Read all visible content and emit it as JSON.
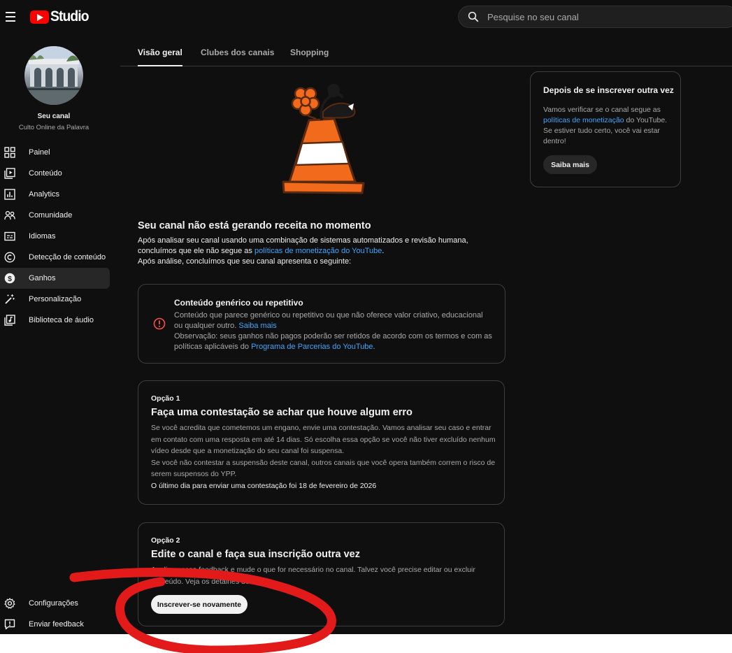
{
  "header": {
    "logo_text": "Studio",
    "search_placeholder": "Pesquise no seu canal"
  },
  "channel": {
    "title": "Seu canal",
    "name": "Culto Online da Palavra"
  },
  "sidebar": {
    "items": [
      {
        "label": "Painel",
        "icon": "dashboard-icon"
      },
      {
        "label": "Conteúdo",
        "icon": "content-icon"
      },
      {
        "label": "Analytics",
        "icon": "analytics-icon"
      },
      {
        "label": "Comunidade",
        "icon": "community-icon"
      },
      {
        "label": "Idiomas",
        "icon": "subtitles-icon"
      },
      {
        "label": "Detecção de conteúdo",
        "icon": "copyright-icon"
      },
      {
        "label": "Ganhos",
        "icon": "earn-icon",
        "active": true
      },
      {
        "label": "Personalização",
        "icon": "magic-wand-icon"
      },
      {
        "label": "Biblioteca de áudio",
        "icon": "audio-library-icon"
      }
    ],
    "bottom": [
      {
        "label": "Configurações",
        "icon": "gear-icon"
      },
      {
        "label": "Enviar feedback",
        "icon": "feedback-icon"
      }
    ]
  },
  "tabs": [
    {
      "label": "Visão geral",
      "active": true
    },
    {
      "label": "Clubes dos canais"
    },
    {
      "label": "Shopping"
    }
  ],
  "main": {
    "headline": "Seu canal não está gerando receita no momento",
    "intro_1a": "Após analisar seu canal usando uma combinação de sistemas automatizados e revisão humana, concluímos que ele não segue as ",
    "intro_link": "políticas de monetização do YouTube",
    "intro_1b": ".",
    "intro_2": "Após análise, concluímos que seu canal apresenta o seguinte:",
    "issue": {
      "title": "Conteúdo genérico ou repetitivo",
      "body_a": "Conteúdo que parece genérico ou repetitivo ou que não oferece valor criativo, educacional ou qualquer outro. ",
      "body_link": "Saiba mais",
      "note_a": "Observação: seus ganhos não pagos poderão ser retidos de acordo com os termos e com as políticas aplicáveis do ",
      "note_link": "Programa de Parcerias do YouTube",
      "note_b": "."
    },
    "option1": {
      "label": "Opção 1",
      "title": "Faça uma contestação se achar que houve algum erro",
      "body_1": "Se você acredita que cometemos um engano, envie uma contestação. Vamos analisar seu caso e entrar em contato com uma resposta em até 14 dias. Só escolha essa opção se você não tiver excluído nenhum vídeo desde que a monetização do seu canal foi suspensa.",
      "body_2": "Se você não contestar a suspensão deste canal, outros canais que você opera também correm o risco de serem suspensos do YPP.",
      "deadline": "O último dia para enviar uma contestação foi 18 de fevereiro de 2026"
    },
    "option2": {
      "label": "Opção 2",
      "title": "Edite o canal e faça sua inscrição outra vez",
      "body": "Analise nosso feedback e mude o que for necessário no canal. Talvez você precise editar ou excluir conteúdo. Veja os detalhes deles.",
      "button": "Inscrever-se novamente"
    }
  },
  "side_card": {
    "title": "Depois de se inscrever outra vez",
    "body_a": "Vamos verificar se o canal segue as ",
    "body_link": "políticas de monetização",
    "body_b": " do YouTube. Se estiver tudo certo, você vai estar dentro!",
    "button": "Saiba mais"
  },
  "colors": {
    "background": "#0f0f0f",
    "link": "#3ea6ff",
    "brand_red": "#ff0000",
    "alert": "#ff4e45",
    "cone_orange": "#f26a1b",
    "annotation_red": "#e21a1a"
  }
}
